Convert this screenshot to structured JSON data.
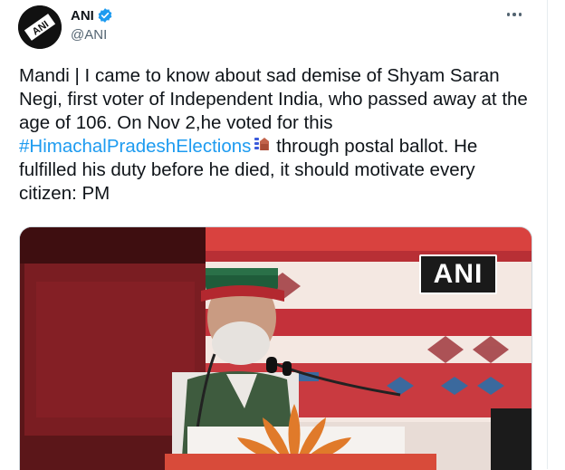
{
  "tweet": {
    "author": {
      "display_name": "ANI",
      "handle": "@ANI",
      "avatar_text": "ANI",
      "verified": true,
      "verified_color": "#1d9bf0"
    },
    "menu_icon": "more-horizontal-icon",
    "text_before": "Mandi | I came to know about sad demise of Shyam Saran Negi, first voter of Independent India, who passed away at the age of 106. On Nov 2,he voted for this ",
    "hashtag": "#HimachalPradeshElections",
    "hashtag_color": "#1d9bf0",
    "emoji": "ballot-box-icon",
    "text_after": " through postal ballot. He fulfilled his duty before he died, it should motivate every citizen: PM",
    "media": {
      "watermark": "ANI"
    }
  }
}
